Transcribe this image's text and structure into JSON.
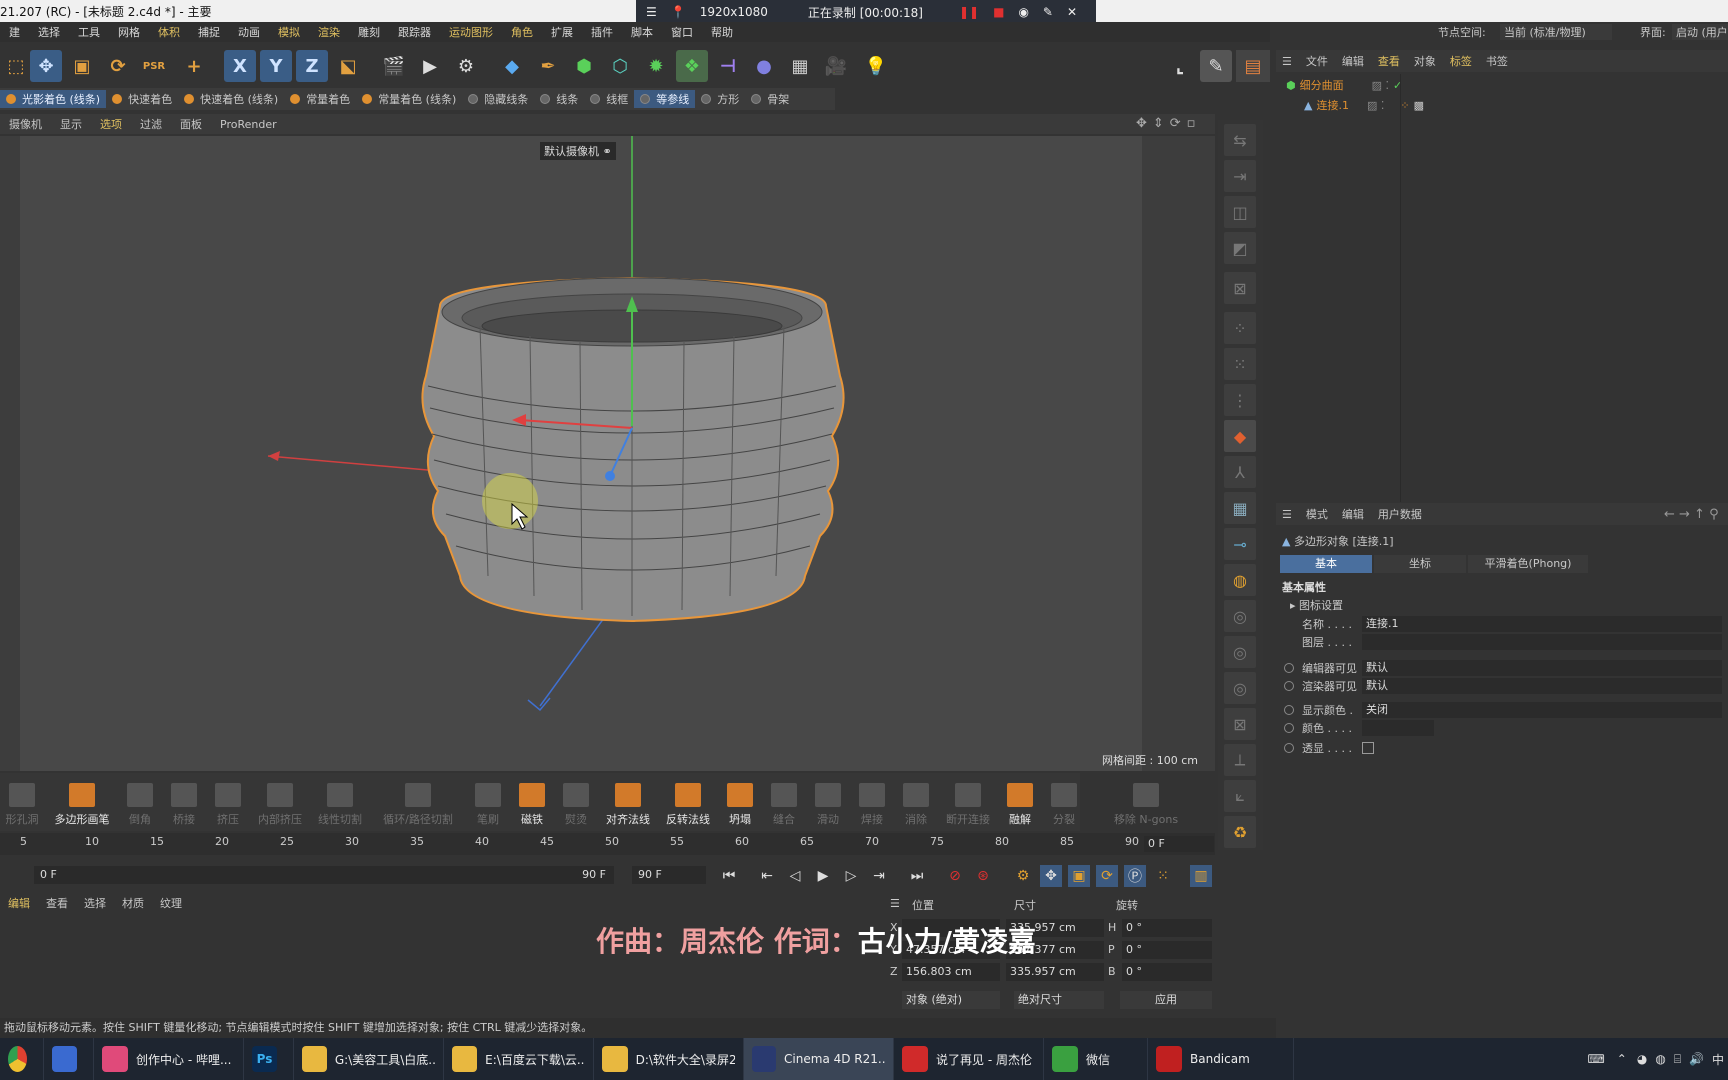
{
  "title_bar": {
    "title": "21.207 (RC) - [未标题 2.c4d *] - 主要"
  },
  "recorder": {
    "resolution": "1920x1080",
    "status": "正在录制 [00:00:18]"
  },
  "menu": [
    "建",
    "选择",
    "工具",
    "网格",
    "体积",
    "捕捉",
    "动画",
    "模拟",
    "渲染",
    "雕刻",
    "跟踪器",
    "运动图形",
    "角色",
    "扩展",
    "插件",
    "脚本",
    "窗口",
    "帮助"
  ],
  "node_space": {
    "label": "节点空间:",
    "value": "当前 (标准/物理)"
  },
  "interface": {
    "label": "界面:",
    "value": "启动 (用户"
  },
  "axis_buttons": [
    "X",
    "Y",
    "Z"
  ],
  "shading": [
    {
      "label": "光影着色 (线条)",
      "active": true
    },
    {
      "label": "快速着色",
      "active": false
    },
    {
      "label": "快速着色 (线条)",
      "active": false
    },
    {
      "label": "常量着色",
      "active": false
    },
    {
      "label": "常量着色 (线条)",
      "active": false
    },
    {
      "label": "隐藏线条",
      "active": false
    },
    {
      "label": "线条",
      "active": false
    },
    {
      "label": "线框",
      "active": false
    },
    {
      "label": "等参线",
      "active": true
    },
    {
      "label": "方形",
      "active": false
    },
    {
      "label": "骨架",
      "active": false
    }
  ],
  "viewport_menu": [
    "摄像机",
    "显示",
    "选项",
    "过滤",
    "面板",
    "ProRender"
  ],
  "viewport": {
    "camera_label": "默认摄像机",
    "grid_spacing": "网格间距 : 100 cm"
  },
  "object_manager": {
    "menu": [
      "文件",
      "编辑",
      "查看",
      "对象",
      "标签",
      "书签"
    ],
    "objects": [
      {
        "name": "细分曲面"
      },
      {
        "name": "连接.1"
      }
    ]
  },
  "attributes": {
    "menu": [
      "模式",
      "编辑",
      "用户数据"
    ],
    "object_title": "多边形对象 [连接.1]",
    "tabs": [
      "基本",
      "坐标",
      "平滑着色(Phong)"
    ],
    "section": "基本属性",
    "subsection": "图标设置",
    "props": [
      {
        "label": "名称 . . . .",
        "value": "连接.1"
      },
      {
        "label": "图层 . . . .",
        "value": ""
      },
      {
        "label": "编辑器可见",
        "value": "默认"
      },
      {
        "label": "渲染器可见",
        "value": "默认"
      },
      {
        "label": "显示颜色 .",
        "value": "关闭"
      },
      {
        "label": "颜色 . . . .",
        "value": ""
      },
      {
        "label": "透显 . . . .",
        "value": ""
      }
    ]
  },
  "bottom_tools": [
    {
      "label": "形孔洞",
      "on": false
    },
    {
      "label": "多边形画笔",
      "on": true
    },
    {
      "label": "倒角",
      "on": false
    },
    {
      "label": "桥接",
      "on": false
    },
    {
      "label": "挤压",
      "on": false
    },
    {
      "label": "内部挤压",
      "on": false
    },
    {
      "label": "线性切割",
      "on": false
    },
    {
      "label": "循环/路径切割",
      "on": false
    },
    {
      "label": "笔刷",
      "on": false
    },
    {
      "label": "磁铁",
      "on": true
    },
    {
      "label": "熨烫",
      "on": false
    },
    {
      "label": "对齐法线",
      "on": true
    },
    {
      "label": "反转法线",
      "on": true
    },
    {
      "label": "坍塌",
      "on": true
    },
    {
      "label": "缝合",
      "on": false
    },
    {
      "label": "滑动",
      "on": false
    },
    {
      "label": "焊接",
      "on": false
    },
    {
      "label": "消除",
      "on": false
    },
    {
      "label": "断开连接",
      "on": false
    },
    {
      "label": "融解",
      "on": true
    },
    {
      "label": "分裂",
      "on": false
    },
    {
      "label": "移除 N-gons",
      "on": false
    }
  ],
  "timeline": {
    "ticks": [
      "5",
      "10",
      "15",
      "20",
      "25",
      "30",
      "35",
      "40",
      "45",
      "50",
      "55",
      "60",
      "65",
      "70",
      "75",
      "80",
      "85",
      "90"
    ],
    "current_frame": "0 F",
    "start": "0 F",
    "end": "90 F",
    "max": "90 F"
  },
  "material_menu": [
    "编辑",
    "查看",
    "选择",
    "材质",
    "纹理"
  ],
  "coords": {
    "headers": [
      "位置",
      "尺寸",
      "旋转"
    ],
    "rows": [
      {
        "axis": "X",
        "pos": "",
        "size": "335.957 cm",
        "rot_axis": "H",
        "rot": "0 °"
      },
      {
        "axis": "Y",
        "pos": "47.357 cm",
        "size": "167.377 cm",
        "rot_axis": "P",
        "rot": "0 °"
      },
      {
        "axis": "Z",
        "pos": "156.803 cm",
        "size": "335.957 cm",
        "rot_axis": "B",
        "rot": "0 °"
      }
    ],
    "mode": "对象 (绝对)",
    "size_mode": "绝对尺寸",
    "apply": "应用"
  },
  "lyric": {
    "part1": "作曲：周杰伦 作词：",
    "part2": "古小力/黄凌嘉"
  },
  "status": "拖动鼠标移动元素。按住 SHIFT 键量化移动; 节点编辑模式时按住 SHIFT 键增加选择对象; 按住 CTRL 键减少选择对象。",
  "taskbar": [
    {
      "label": "创作中心 - 哔哩...",
      "color": "#e04a7a"
    },
    {
      "label": "G:\\美容工具\\白底...",
      "color": "#e8b840"
    },
    {
      "label": "E:\\百度云下载\\云...",
      "color": "#e8b840"
    },
    {
      "label": "D:\\软件大全\\录屏2",
      "color": "#e8b840"
    },
    {
      "label": "Cinema 4D R21....",
      "color": "#2a3a70"
    },
    {
      "label": "说了再见 - 周杰伦",
      "color": "#d02a2a"
    },
    {
      "label": "微信",
      "color": "#3aa040"
    },
    {
      "label": "Bandicam",
      "color": "#c02020"
    }
  ],
  "colors": {
    "accent": "#3c5a80",
    "highlight_orange": "#e09030",
    "selection_outline": "#e8963a"
  }
}
